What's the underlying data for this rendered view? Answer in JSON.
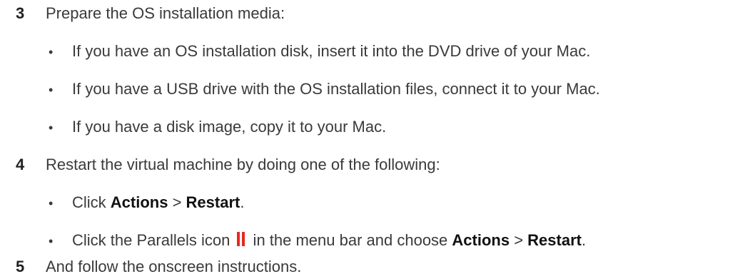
{
  "steps": [
    {
      "number": "3",
      "text": "Prepare the OS installation media:",
      "bullets": [
        "If you have an OS installation disk, insert it into the DVD drive of your Mac.",
        "If you have a USB drive with the OS installation files, connect it to your Mac.",
        "If you have a disk image, copy it to your Mac."
      ]
    },
    {
      "number": "4",
      "text": "Restart the virtual machine by doing one of the following:",
      "bullet1": {
        "prefix": "Click ",
        "menu": "Actions",
        "sep": " > ",
        "item": "Restart",
        "suffix": "."
      },
      "bullet2": {
        "prefix": "Click the Parallels icon ",
        "icon": "parallels-icon",
        "middle": " in the menu bar and choose ",
        "menu": "Actions",
        "sep": " > ",
        "item": "Restart",
        "suffix": "."
      }
    },
    {
      "number": "5",
      "text": "And follow the onscreen instructions."
    }
  ],
  "bullet_glyph": "•",
  "colors": {
    "text": "#3a3a3a",
    "icon_red": "#e8281f"
  }
}
